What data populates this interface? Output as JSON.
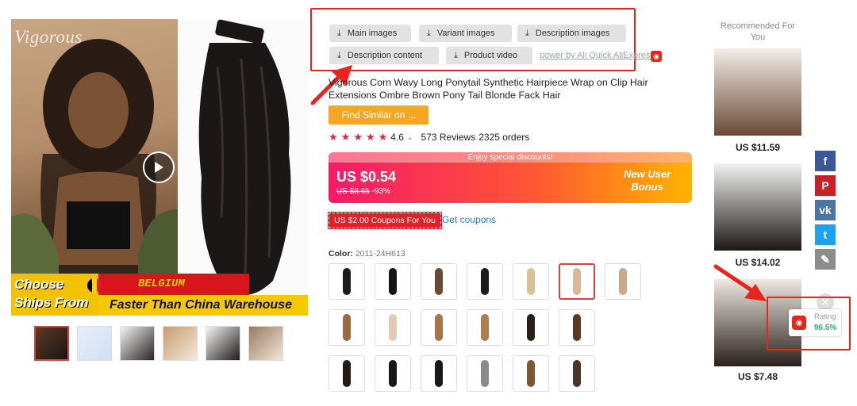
{
  "product_image": {
    "brand_logo": "Vigorous",
    "banner": {
      "choose_line1": "Choose",
      "choose_line2": "Ships From",
      "country": "BELGIUM",
      "tagline": "Faster Than China Warehouse"
    }
  },
  "toolbar": {
    "buttons": [
      "Main images",
      "Variant images",
      "Description images",
      "Description content",
      "Product video"
    ],
    "powered_by": "power by Ali Quick AliExpress"
  },
  "product": {
    "title": "Vigorous Corn Wavy Long Ponytail Synthetic Hairpiece Wrap on Clip Hair Extensions Ombre Brown Pony Tail Blonde Fack Hair",
    "find_similar": "Find Similar on ...",
    "rating": "4.6",
    "rating_stars": 5,
    "reviews": "573 Reviews",
    "orders": "2325 orders",
    "enjoy_text": "Enjoy special discounts!",
    "price": "US $0.54",
    "original_price": "US $8.65",
    "discount": "-93%",
    "new_user_line1": "New User",
    "new_user_line2": "Bonus",
    "coupon_badge": "US $2.00 Coupons For You",
    "get_coupons": "Get coupons",
    "color_label": "Color:",
    "color_value": "2011-24H613"
  },
  "swatches": [
    {
      "color": "#1f1b18",
      "sel": false
    },
    {
      "color": "#151515",
      "sel": false
    },
    {
      "color": "#6b4a33",
      "sel": false
    },
    {
      "color": "#1e1a17",
      "sel": false
    },
    {
      "color": "#d9c193",
      "sel": false
    },
    {
      "color": "#d8b896",
      "sel": true
    },
    {
      "color": "#c9a98a",
      "sel": false
    },
    {
      "color": "#9a6a43",
      "sel": false
    },
    {
      "color": "#e2cbb4",
      "sel": false
    },
    {
      "color": "#a67648",
      "sel": false
    },
    {
      "color": "#b07c4d",
      "sel": false
    },
    {
      "color": "#2c1f18",
      "sel": false
    },
    {
      "color": "#5a3a26",
      "sel": false
    },
    {
      "color": "#241a16",
      "sel": false
    },
    {
      "color": "#1a1817",
      "sel": false
    },
    {
      "color": "#1c1917",
      "sel": false
    },
    {
      "color": "#8a8a8a",
      "sel": false
    },
    {
      "color": "#7a5a33",
      "sel": false
    },
    {
      "color": "#4b3428",
      "sel": false
    }
  ],
  "recommended": {
    "title": "Recommended For You",
    "items": [
      {
        "price": "US $11.59"
      },
      {
        "price": "US $14.02"
      },
      {
        "price": "US $7.48"
      }
    ]
  },
  "share": [
    {
      "name": "facebook",
      "glyph": "f",
      "color": "#3b5998"
    },
    {
      "name": "pinterest",
      "glyph": "P",
      "color": "#cb2027"
    },
    {
      "name": "vk",
      "glyph": "vk",
      "color": "#4c75a3"
    },
    {
      "name": "twitter",
      "glyph": "t",
      "color": "#1da1f2"
    },
    {
      "name": "edit",
      "glyph": "✎",
      "color": "#8c8c8c"
    }
  ],
  "rating_widget": {
    "label": "Rating",
    "value": "96.5%"
  },
  "colors": {
    "accent_red": "#e8241f",
    "find_similar_bg": "#f5a623",
    "link_blue": "#2a7fd4",
    "rating_green": "#21b36b"
  }
}
